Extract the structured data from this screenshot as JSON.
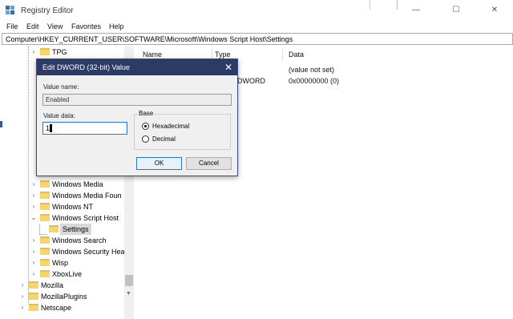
{
  "window": {
    "title": "Registry Editor",
    "minimize_glyph": "—",
    "maximize_glyph": "☐",
    "close_glyph": "✕"
  },
  "menu": [
    "File",
    "Edit",
    "View",
    "Favorites",
    "Help"
  ],
  "address": "Computer\\HKEY_CURRENT_USER\\SOFTWARE\\Microsoft\\Windows Script Host\\Settings",
  "tree": {
    "items": [
      {
        "label": "TPG",
        "chevron": "›"
      },
      {
        "label": "Windows Media",
        "chevron": "›"
      },
      {
        "label": "Windows Media Foun",
        "chevron": "›"
      },
      {
        "label": "Windows NT",
        "chevron": "›"
      },
      {
        "label": "Windows Script Host",
        "chevron": "⌄"
      },
      {
        "label": "Settings",
        "chevron": ""
      },
      {
        "label": "Windows Search",
        "chevron": "›"
      },
      {
        "label": "Windows Security Hea",
        "chevron": "›"
      },
      {
        "label": "Wisp",
        "chevron": "›"
      },
      {
        "label": "XboxLive",
        "chevron": "›"
      },
      {
        "label": "Mozilla",
        "chevron": "›"
      },
      {
        "label": "MozillaPlugins",
        "chevron": "›"
      },
      {
        "label": "Netscape",
        "chevron": "›"
      }
    ],
    "selected": "Settings"
  },
  "list": {
    "columns": [
      "Name",
      "Type",
      "Data"
    ],
    "rows": [
      {
        "type_partial": "",
        "data": "(value not set)"
      },
      {
        "type_partial": "DWORD",
        "data": "0x00000000 (0)"
      }
    ]
  },
  "dialog": {
    "title": "Edit DWORD (32-bit) Value",
    "value_name_label": "Value name:",
    "value_name": "Enabled",
    "value_data_label": "Value data:",
    "value_data": "1",
    "base_label": "Base",
    "base_options": [
      "Hexadecimal",
      "Decimal"
    ],
    "base_selected": "Hexadecimal",
    "ok_label": "OK",
    "cancel_label": "Cancel",
    "close_glyph": "✕"
  },
  "colors": {
    "dialog_title_bg": "#2b3a67",
    "folder": "#f7d56a",
    "accent": "#2f74c9"
  }
}
